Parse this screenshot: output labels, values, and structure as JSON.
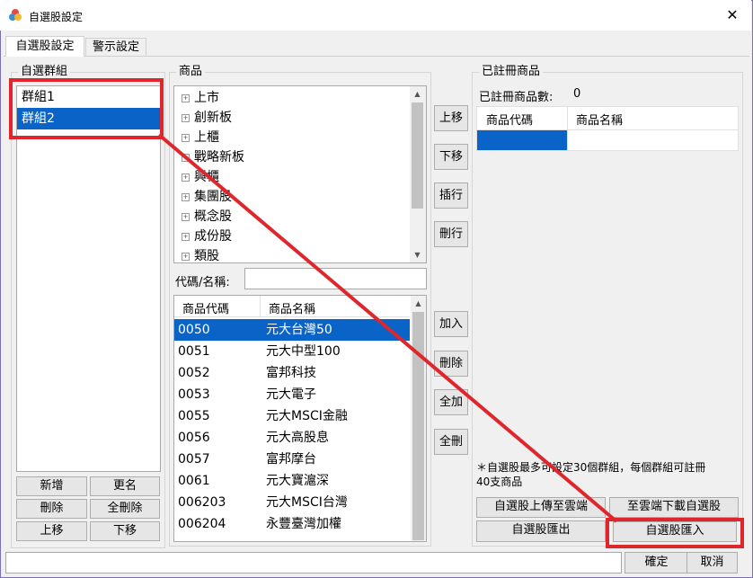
{
  "window": {
    "title": "自選股設定",
    "close": "✕"
  },
  "tabs": [
    "自選股設定",
    "警示設定"
  ],
  "groups": {
    "legend": "自選群組",
    "items": [
      "群組1",
      "群組2"
    ],
    "selected_index": 1,
    "buttons": [
      "新增",
      "更名",
      "刪除",
      "全刪除",
      "上移",
      "下移"
    ]
  },
  "products": {
    "legend": "商品",
    "tree": [
      "上市",
      "創新板",
      "上櫃",
      "戰略新板",
      "興櫃",
      "集團股",
      "概念股",
      "成份股",
      "類股"
    ],
    "search_label": "代碼/名稱:",
    "search_value": "",
    "columns": [
      "商品代碼",
      "商品名稱"
    ],
    "rows": [
      [
        "0050",
        "元大台灣50"
      ],
      [
        "0051",
        "元大中型100"
      ],
      [
        "0052",
        "富邦科技"
      ],
      [
        "0053",
        "元大電子"
      ],
      [
        "0055",
        "元大MSCI金融"
      ],
      [
        "0056",
        "元大高股息"
      ],
      [
        "0057",
        "富邦摩台"
      ],
      [
        "0061",
        "元大寶滬深"
      ],
      [
        "006203",
        "元大MSCI台灣"
      ],
      [
        "006204",
        "永豐臺灣加權"
      ]
    ],
    "selected_index": 0
  },
  "middle_buttons": [
    "上移",
    "下移",
    "插行",
    "刪行",
    "加入",
    "刪除",
    "全加",
    "全刪"
  ],
  "registered": {
    "legend": "已註冊商品",
    "count_label": "已註冊商品數:",
    "count": "0",
    "columns": [
      "商品代碼",
      "商品名稱"
    ],
    "note": "＊自選股最多可設定30個群組，每個群組可註冊40支商品",
    "buttons": [
      "自選股上傳至雲端",
      "至雲端下載自選股",
      "自選股匯出",
      "自選股匯入"
    ]
  },
  "footer": {
    "status": "",
    "ok": "確定",
    "cancel": "取消"
  },
  "colors": {
    "highlight": "#e0262d",
    "selection": "#0a64c8"
  }
}
